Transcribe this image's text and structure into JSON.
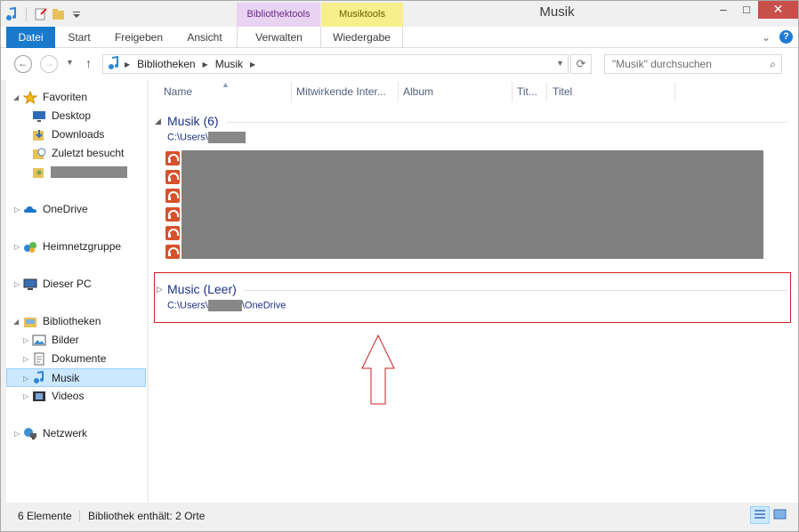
{
  "window": {
    "title": "Musik",
    "context_tabs": [
      "Bibliothektools",
      "Musiktools"
    ],
    "controls": {
      "minimize": "‒",
      "maximize": "□",
      "close": "✕"
    }
  },
  "ribbon": {
    "tabs": [
      "Datei",
      "Start",
      "Freigeben",
      "Ansicht",
      "Verwalten",
      "Wiedergabe"
    ],
    "help_label": "?"
  },
  "address": {
    "breadcrumbs": [
      "Bibliotheken",
      "Musik"
    ],
    "search_placeholder": "\"Musik\" durchsuchen"
  },
  "nav_pane": {
    "items": [
      {
        "label": "Favoriten",
        "icon": "star-icon"
      },
      {
        "label": "Desktop",
        "icon": "desktop-icon"
      },
      {
        "label": "Downloads",
        "icon": "downloads-icon"
      },
      {
        "label": "Zuletzt besucht",
        "icon": "recent-places-icon"
      },
      {
        "label": "",
        "icon": "user-folder-icon"
      },
      {
        "label": "OneDrive",
        "icon": "onedrive-icon"
      },
      {
        "label": "Heimnetzgruppe",
        "icon": "homegroup-icon"
      },
      {
        "label": "Dieser PC",
        "icon": "computer-icon"
      },
      {
        "label": "Bibliotheken",
        "icon": "libraries-icon"
      },
      {
        "label": "Bilder",
        "icon": "pictures-icon"
      },
      {
        "label": "Dokumente",
        "icon": "documents-icon"
      },
      {
        "label": "Musik",
        "icon": "music-icon"
      },
      {
        "label": "Videos",
        "icon": "videos-icon"
      },
      {
        "label": "Netzwerk",
        "icon": "network-icon"
      }
    ]
  },
  "columns": [
    "Name",
    "Mitwirkende Inter...",
    "Album",
    "Tit...",
    "Titel"
  ],
  "groups": [
    {
      "title": "Musik (6)",
      "path_prefix": "C:\\Users\\",
      "path_suffix": ""
    },
    {
      "title": "Music (Leer)",
      "path_prefix": "C:\\Users\\",
      "path_suffix": "\\OneDrive"
    }
  ],
  "file_count": 6,
  "status": {
    "items": "6 Elemente",
    "library_info": "Bibliothek enthält: 2 Orte"
  },
  "colors": {
    "accent": "#1979ca",
    "highlight": "#cc1f1f",
    "group_text": "#1e3287"
  }
}
